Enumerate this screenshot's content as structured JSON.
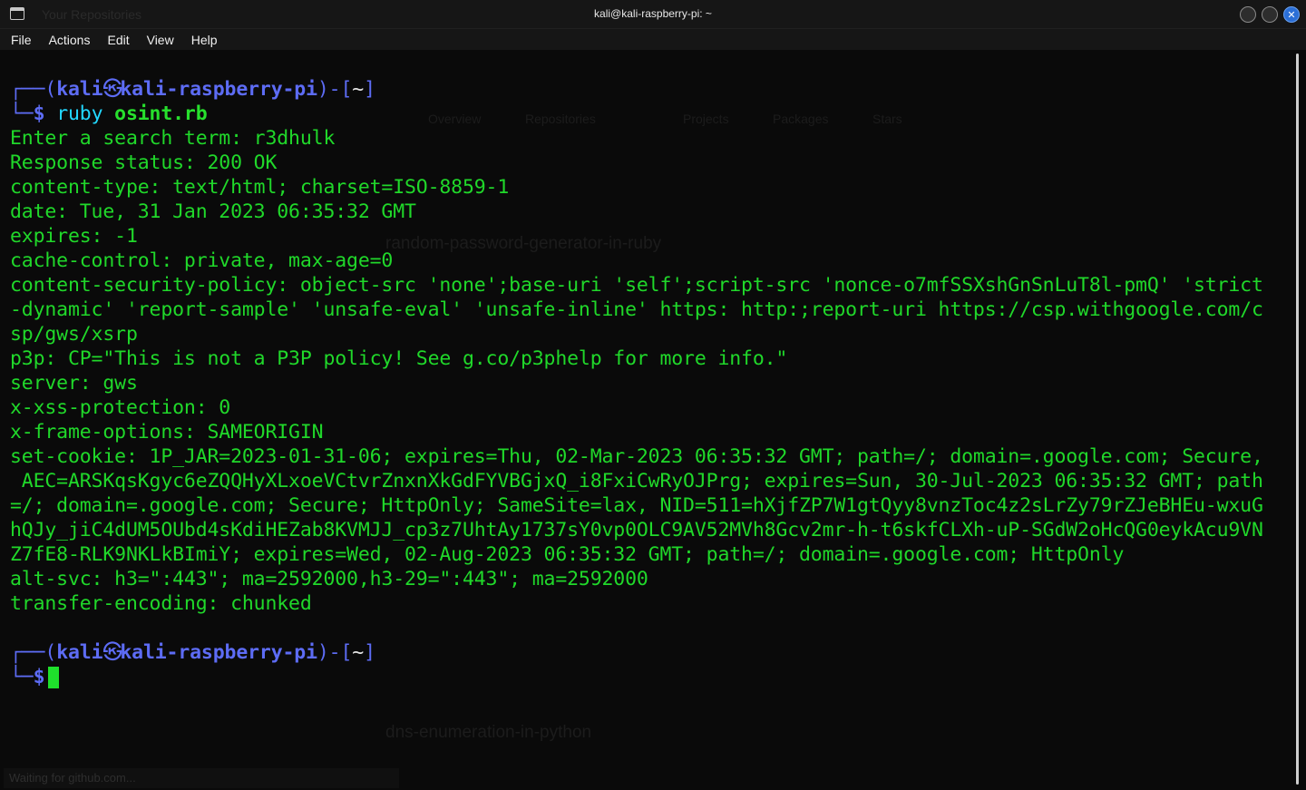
{
  "window": {
    "title": "kali@kali-raspberry-pi: ~",
    "background_tab_text": "Your Repositories",
    "buttons": {
      "minimize": "",
      "maximize": "",
      "close": "✕"
    }
  },
  "menu": [
    "File",
    "Actions",
    "Edit",
    "View",
    "Help"
  ],
  "terminal": {
    "prompt": {
      "user": "kali",
      "host": "kali-raspberry-pi",
      "dir": "~",
      "symbol": "$",
      "glyph": "㉿"
    },
    "command": {
      "program": "ruby",
      "argument": "osint.rb"
    },
    "output": [
      "Enter a search term: r3dhulk",
      "Response status: 200 OK",
      "content-type: text/html; charset=ISO-8859-1",
      "date: Tue, 31 Jan 2023 06:35:32 GMT",
      "expires: -1",
      "cache-control: private, max-age=0",
      "content-security-policy: object-src 'none';base-uri 'self';script-src 'nonce-o7mfSSXshGnSnLuT8l-pmQ' 'strict",
      "-dynamic' 'report-sample' 'unsafe-eval' 'unsafe-inline' https: http:;report-uri https://csp.withgoogle.com/c",
      "sp/gws/xsrp",
      "p3p: CP=\"This is not a P3P policy! See g.co/p3phelp for more info.\"",
      "server: gws",
      "x-xss-protection: 0",
      "x-frame-options: SAMEORIGIN",
      "set-cookie: 1P_JAR=2023-01-31-06; expires=Thu, 02-Mar-2023 06:35:32 GMT; path=/; domain=.google.com; Secure,",
      " AEC=ARSKqsKgyc6eZQQHyXLxoeVCtvrZnxnXkGdFYVBGjxQ_i8FxiCwRyOJPrg; expires=Sun, 30-Jul-2023 06:35:32 GMT; path",
      "=/; domain=.google.com; Secure; HttpOnly; SameSite=lax, NID=511=hXjfZP7W1gtQyy8vnzToc4z2sLrZy79rZJeBHEu-wxuG",
      "hQJy_jiC4dUM5OUbd4sKdiHEZab8KVMJJ_cp3z7UhtAy1737sY0vp0OLC9AV52MVh8Gcv2mr-h-t6skfCLXh-uP-SGdW2oHcQG0eykAcu9VN",
      "Z7fE8-RLK9NKLkBImiY; expires=Wed, 02-Aug-2023 06:35:32 GMT; path=/; domain=.google.com; HttpOnly",
      "alt-svc: h3=\":443\"; ma=2592000,h3-29=\":443\"; ma=2592000",
      "transfer-encoding: chunked",
      ""
    ]
  },
  "background_ghosts": {
    "repo1": "random-password-generator-in-ruby",
    "repo2": "dns-enumeration-in-python",
    "status": "Waiting for github.com...",
    "tab_overview": "Overview",
    "tab_repositories": "Repositories",
    "tab_projects": "Projects",
    "tab_packages": "Packages",
    "tab_stars": "Stars"
  }
}
